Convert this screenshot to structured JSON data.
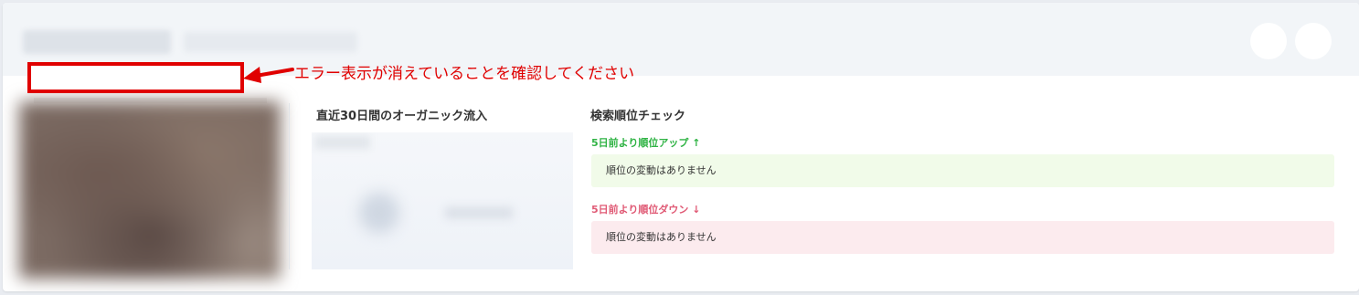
{
  "annotation": {
    "text": "エラー表示が消えていることを確認してください",
    "color": "#e00000"
  },
  "widgets": {
    "organic": {
      "title": "直近30日間のオーガニック流入"
    },
    "ranking": {
      "title": "検索順位チェック",
      "up": {
        "heading": "5日前より順位アップ",
        "arrow": "↑",
        "message": "順位の変動はありません",
        "color": "#2fb344",
        "background": "#f1fbe9"
      },
      "down": {
        "heading": "5日前より順位ダウン",
        "arrow": "↓",
        "message": "順位の変動はありません",
        "color": "#e05a75",
        "background": "#fcebee"
      }
    }
  },
  "icons": {
    "header_buttons": [
      "header-action-icon",
      "header-action-icon"
    ],
    "annotation_pointer": "red-arrow-icon"
  }
}
